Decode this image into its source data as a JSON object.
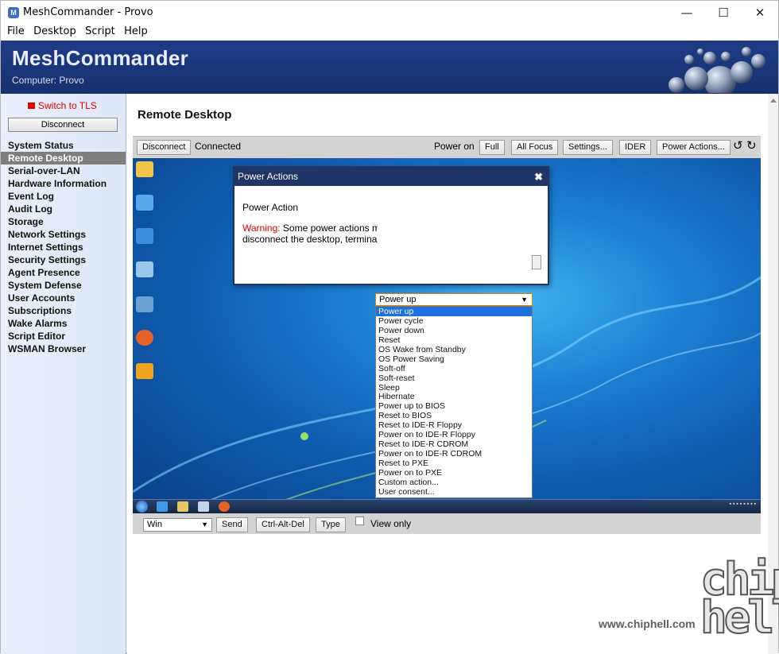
{
  "window": {
    "title": "MeshCommander - Provo",
    "app_icon": "M",
    "minimize": "—",
    "maximize": "☐",
    "close": "✕"
  },
  "menu": [
    "File",
    "Desktop",
    "Script",
    "Help"
  ],
  "banner": {
    "app_title": "MeshCommander",
    "computer_label": "Computer: Provo"
  },
  "sidebar": {
    "switch_tls": "Switch to TLS",
    "disconnect": "Disconnect",
    "items": [
      {
        "label": "System Status",
        "active": false
      },
      {
        "label": "Remote Desktop",
        "active": true
      },
      {
        "label": "Serial-over-LAN",
        "active": false
      },
      {
        "label": "Hardware Information",
        "active": false
      },
      {
        "label": "Event Log",
        "active": false
      },
      {
        "label": "Audit Log",
        "active": false
      },
      {
        "label": "Storage",
        "active": false
      },
      {
        "label": "Network Settings",
        "active": false
      },
      {
        "label": "Internet Settings",
        "active": false
      },
      {
        "label": "Security Settings",
        "active": false
      },
      {
        "label": "Agent Presence",
        "active": false
      },
      {
        "label": "System Defense",
        "active": false
      },
      {
        "label": "User Accounts",
        "active": false
      },
      {
        "label": "Subscriptions",
        "active": false
      },
      {
        "label": "Wake Alarms",
        "active": false
      },
      {
        "label": "Script Editor",
        "active": false
      },
      {
        "label": "WSMAN Browser",
        "active": false
      }
    ]
  },
  "main": {
    "page_title": "Remote Desktop",
    "toolbar": {
      "disconnect": "Disconnect",
      "status": "Connected",
      "power_state": "Power on",
      "full": "Full",
      "all_focus": "All Focus",
      "settings": "Settings...",
      "ider": "IDER",
      "power_actions": "Power Actions...",
      "rotate_left": "↺",
      "rotate_right": "↻"
    },
    "bottom": {
      "key_select": "Win",
      "send": "Send",
      "ctrl_alt_del": "Ctrl-Alt-Del",
      "type": "Type",
      "view_only": "View only"
    },
    "desktop_icon_colors": [
      "#f2c54a",
      "#5aa9ea",
      "#3c8dde",
      "#9cc6ea",
      "#6aa2d2",
      "#e5622a",
      "#f0a51f"
    ]
  },
  "dialog": {
    "title": "Power Actions",
    "close": "✖",
    "power_action_label": "Power Action",
    "selected": "Power up",
    "warning_prefix": "Warning:",
    "warning_line1": " Some power actions m",
    "warning_line2": "disconnect the desktop, termina",
    "options": [
      "Power up",
      "Power cycle",
      "Power down",
      "Reset",
      "OS Wake from Standby",
      "OS Power Saving",
      "Soft-off",
      "Soft-reset",
      "Sleep",
      "Hibernate",
      "Power up to BIOS",
      "Reset to BIOS",
      "Reset to IDE-R Floppy",
      "Power on to IDE-R Floppy",
      "Reset to IDE-R CDROM",
      "Power on to IDE-R CDROM",
      "Reset to PXE",
      "Power on to PXE",
      "Custom action...",
      "User consent..."
    ]
  },
  "watermark": {
    "url": "www.chiphell.com",
    "logo": "chip hell"
  },
  "colors": {
    "banner": "#1e3c86",
    "active_nav": "#7e7e7e",
    "dialog_header": "#1e3566",
    "warning": "#e00000",
    "selected_option": "#1e6fe0"
  }
}
